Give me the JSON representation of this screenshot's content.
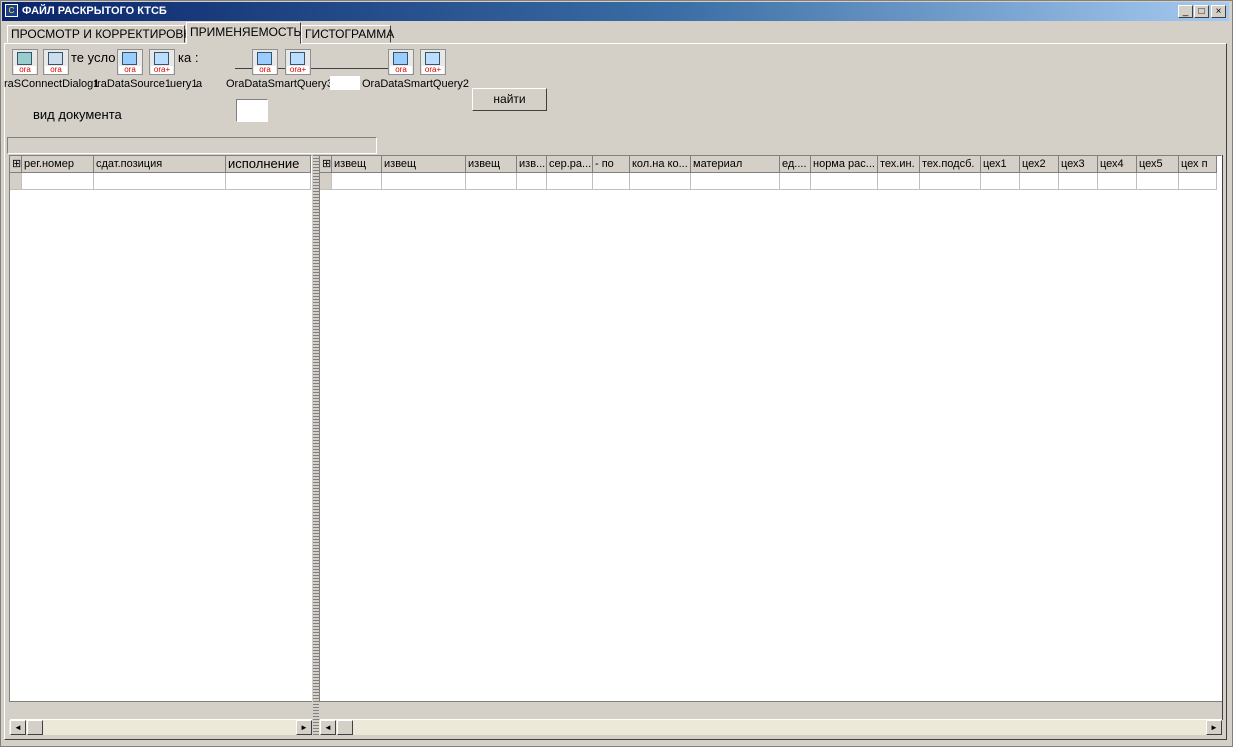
{
  "window": {
    "title": "ФАЙЛ РАСКРЫТОГО КТСБ",
    "min": "_",
    "max": "□",
    "close": "×"
  },
  "tabs": [
    {
      "label": "ПРОСМОТР И КОРРЕКТИРОВКА"
    },
    {
      "label": "ПРИМЕНЯЕМОСТЬ"
    },
    {
      "label": "ГИСТОГРАММА"
    }
  ],
  "components": {
    "search_text": "те усло",
    "search_text2": "ка :",
    "label1": "raSConnectDialog1",
    "label2": "traDataSource1",
    "label3": "uery1",
    "label4": "a",
    "query3": "OraDataSmartQuery3",
    "query2": "OraDataSmartQuery2",
    "icon_tag": "ora",
    "icon_tag_plus": "ora+"
  },
  "form": {
    "doc_type_label": "вид документа",
    "doc_type_value": "",
    "find_button": "найти"
  },
  "left_grid": {
    "columns": [
      "рег.номер",
      "сдат.позиция",
      "исполнение"
    ]
  },
  "right_grid": {
    "columns": [
      "извещ",
      "извещ",
      "извещ",
      "изв...",
      "сер.ра...",
      "- по",
      "кол.на ко...",
      "материал",
      "ед....",
      "норма рас...",
      "тех.ин.",
      "тех.подсб.",
      "цех1",
      "цех2",
      "цех3",
      "цех4",
      "цех5",
      "цех п"
    ]
  },
  "scroll": {
    "left_arrow": "◄",
    "right_arrow": "►"
  }
}
